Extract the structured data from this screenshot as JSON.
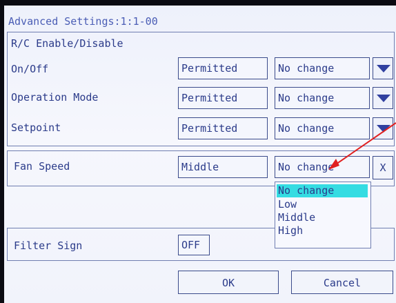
{
  "title": "Advanced Settings:1:1-00",
  "rc_section": {
    "heading": "R/C Enable/Disable",
    "rows": [
      {
        "label": "On/Off",
        "value": "Permitted",
        "select": "No change"
      },
      {
        "label": "Operation Mode",
        "value": "Permitted",
        "select": "No change"
      },
      {
        "label": "Setpoint",
        "value": "Permitted",
        "select": "No change"
      }
    ]
  },
  "fan": {
    "label": "Fan Speed",
    "value": "Middle",
    "select": "No change",
    "clear_label": "X",
    "options": [
      "No change",
      "Low",
      "Middle",
      "High"
    ],
    "selected_option": "No change"
  },
  "filter": {
    "label": "Filter Sign",
    "value": "OFF"
  },
  "buttons": {
    "ok": "OK",
    "cancel": "Cancel"
  },
  "icons": {
    "dropdown": "triangle-down-icon",
    "annotation": "red-arrow"
  },
  "colors": {
    "text": "#2b3b8a",
    "highlight": "#35dce2",
    "annotation": "#e02020"
  }
}
